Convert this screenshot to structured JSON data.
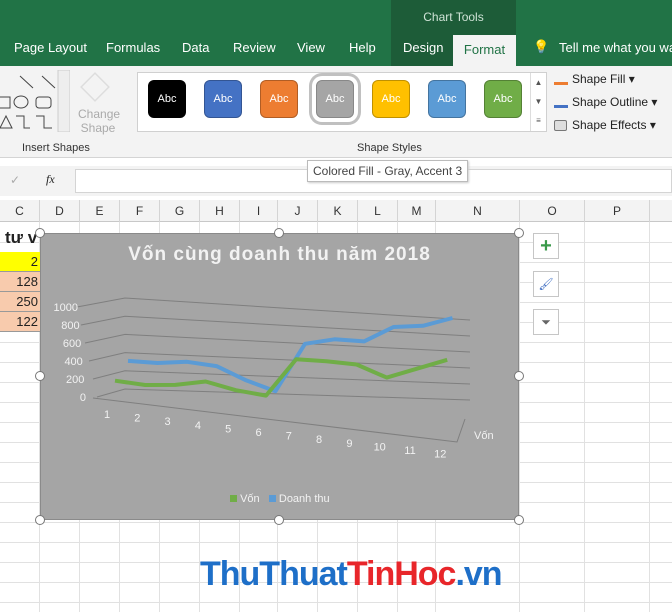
{
  "ribbon": {
    "context_title": "Chart Tools",
    "tabs": [
      "Page Layout",
      "Formulas",
      "Data",
      "Review",
      "View",
      "Help",
      "Design",
      "Format"
    ],
    "active_tab": "Format",
    "tell_me": "Tell me what you want",
    "groups": {
      "insert_shapes": "Insert Shapes",
      "shape_styles": "Shape Styles"
    },
    "change_shape": [
      "Change",
      "Shape"
    ],
    "styles": [
      {
        "label": "Abc",
        "color": "#000000"
      },
      {
        "label": "Abc",
        "color": "#4472c4"
      },
      {
        "label": "Abc",
        "color": "#ed7d31"
      },
      {
        "label": "Abc",
        "color": "#a5a5a5",
        "selected": true
      },
      {
        "label": "Abc",
        "color": "#ffc000"
      },
      {
        "label": "Abc",
        "color": "#5b9bd5"
      },
      {
        "label": "Abc",
        "color": "#70ad47"
      }
    ],
    "commands": [
      "Shape Fill",
      "Shape Outline",
      "Shape Effects"
    ],
    "tooltip": "Colored Fill - Gray, Accent 3"
  },
  "formula_bar": {
    "fx": "fx",
    "check": "✓",
    "value": ""
  },
  "columns": [
    "C",
    "D",
    "E",
    "F",
    "G",
    "H",
    "I",
    "J",
    "K",
    "L",
    "M",
    "N",
    "O",
    "P"
  ],
  "cells": {
    "title_fragment": "tư v",
    "values": [
      "2",
      "128",
      "250",
      "122"
    ]
  },
  "chart_data": {
    "type": "line",
    "title": "Vốn cùng doanh thu năm 2018",
    "categories": [
      "1",
      "2",
      "3",
      "4",
      "5",
      "6",
      "7",
      "8",
      "9",
      "10",
      "11",
      "12"
    ],
    "y_ticks": [
      "0",
      "200",
      "400",
      "600",
      "800",
      "1000"
    ],
    "ylim": [
      0,
      1000
    ],
    "depth_label": "Vốn",
    "grid": true,
    "legend": "bottom",
    "series": [
      {
        "name": "Vốn",
        "color": "#70ad47",
        "values": [
          130,
          100,
          110,
          150,
          80,
          40,
          380,
          370,
          350,
          240,
          330,
          420
        ]
      },
      {
        "name": "Doanh thu",
        "color": "#5b9bd5",
        "values": [
          310,
          300,
          320,
          290,
          170,
          80,
          520,
          570,
          560,
          700,
          720,
          800
        ]
      }
    ]
  },
  "watermark": "ThuThuatTinHoc.vn"
}
